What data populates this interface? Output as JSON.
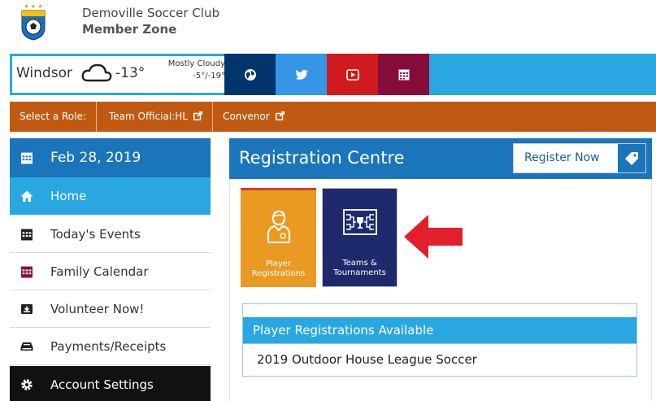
{
  "header": {
    "club_name": "Demoville Soccer Club",
    "zone_name": "Member Zone",
    "logo_text": "SOCCER"
  },
  "weather": {
    "city": "Windsor",
    "icon": "cloud-icon",
    "temperature": "-13°",
    "condition": "Mostly Cloudy",
    "range": "-5°/-19°"
  },
  "social": [
    {
      "name": "globe-icon",
      "color": "#00356b"
    },
    {
      "name": "twitter-icon",
      "color": "#3596e8"
    },
    {
      "name": "youtube-icon",
      "color": "#d01b1e"
    },
    {
      "name": "calendar-icon",
      "color": "#840d3c"
    }
  ],
  "roles": {
    "label": "Select a Role:",
    "items": [
      "Team Official:HL",
      "Convenor"
    ]
  },
  "sidebar": {
    "date": "Feb 28, 2019",
    "items": [
      {
        "label": "Home",
        "icon": "home-icon",
        "active": true
      },
      {
        "label": "Today's Events",
        "icon": "calendar-icon"
      },
      {
        "label": "Family Calendar",
        "icon": "calendar-icon"
      },
      {
        "label": "Volunteer Now!",
        "icon": "inbox-icon"
      },
      {
        "label": "Payments/Receipts",
        "icon": "payment-icon"
      },
      {
        "label": "Account Settings",
        "icon": "gear-icon"
      }
    ]
  },
  "registration": {
    "title": "Registration Centre",
    "register_button": "Register Now",
    "tiles": [
      {
        "label_line1": "Player",
        "label_line2": "Registrations",
        "icon": "player-icon"
      },
      {
        "label_line1": "Teams &",
        "label_line2": "Tournaments",
        "icon": "tournament-bracket-icon"
      }
    ],
    "available_title": "Player Registrations Available",
    "available_items": [
      "2019 Outdoor House League Soccer"
    ]
  },
  "colors": {
    "accent_blue": "#29a7e1",
    "dark_blue": "#1a75bb",
    "role_orange": "#c05a12",
    "tile_orange": "#ea9a22",
    "tile_navy": "#1e2a6c",
    "arrow_red": "#e3202a"
  }
}
